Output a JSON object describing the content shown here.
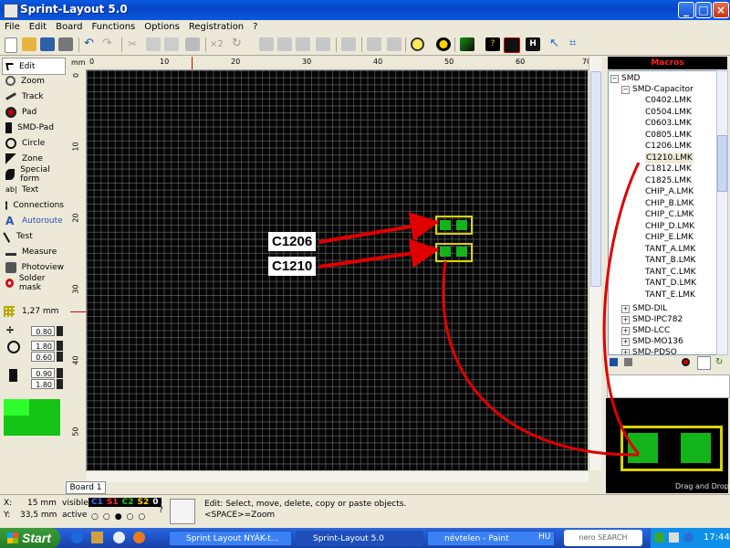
{
  "window": {
    "title": "Sprint-Layout 5.0",
    "min": "_",
    "max": "□",
    "close": "×"
  },
  "menu": [
    "File",
    "Edit",
    "Board",
    "Functions",
    "Options",
    "Registration",
    "?"
  ],
  "toolbar": {
    "x2_label": "×2"
  },
  "tools": {
    "items": [
      {
        "label": "Edit",
        "icon": "cursor-arrow-icon"
      },
      {
        "label": "Zoom",
        "icon": "magnifier-icon"
      },
      {
        "label": "Track",
        "icon": "track-pen-icon"
      },
      {
        "label": "Pad",
        "icon": "pad-icon"
      },
      {
        "label": "SMD-Pad",
        "icon": "smd-pad-icon"
      },
      {
        "label": "Circle",
        "icon": "circle-icon"
      },
      {
        "label": "Zone",
        "icon": "zone-icon"
      },
      {
        "label": "Special form",
        "icon": "special-form-icon"
      },
      {
        "label": "Text",
        "icon": "text-icon"
      },
      {
        "label": "Connections",
        "icon": "connections-icon"
      },
      {
        "label": "Autoroute",
        "icon": "autoroute-icon"
      },
      {
        "label": "Test",
        "icon": "test-icon"
      },
      {
        "label": "Measure",
        "icon": "measure-icon"
      },
      {
        "label": "Photoview",
        "icon": "photoview-icon"
      },
      {
        "label": "Solder mask",
        "icon": "solder-mask-icon"
      }
    ],
    "grid_label": "1,27 mm",
    "values": {
      "track_width": "0.80",
      "pad_outer": "1.80",
      "pad_inner": "0.60",
      "smd_w": "0.90",
      "smd_h": "1.80"
    }
  },
  "ruler": {
    "unit": "mm",
    "top": [
      "0",
      "10",
      "20",
      "30",
      "40",
      "50",
      "60",
      "70"
    ],
    "left": [
      "0",
      "10",
      "20",
      "30",
      "40",
      "50"
    ]
  },
  "callouts": {
    "a": "C1206",
    "b": "C1210"
  },
  "board_tab": "Board 1",
  "macros": {
    "title": "Macros",
    "root": "SMD",
    "group": "SMD-Capacitor",
    "files": [
      "C0402.LMK",
      "C0504.LMK",
      "C0603.LMK",
      "C0805.LMK",
      "C1206.LMK",
      "C1210.LMK",
      "C1812.LMK",
      "C1825.LMK",
      "CHIP_A.LMK",
      "CHIP_B.LMK",
      "CHIP_C.LMK",
      "CHIP_D.LMK",
      "CHIP_E.LMK",
      "TANT_A.LMK",
      "TANT_B.LMK",
      "TANT_C.LMK",
      "TANT_D.LMK",
      "TANT_E.LMK"
    ],
    "selected": "C1210.LMK",
    "other_groups": [
      "SMD-DIL",
      "SMD-IPC782",
      "SMD-LCC",
      "SMD-MO136",
      "SMD-PDSO"
    ],
    "preview_label": "Drag and Drop"
  },
  "status": {
    "x_label": "X:",
    "x_value": "15 mm",
    "y_label": "Y:",
    "y_value": "33,5 mm",
    "visible_label": "visible",
    "active_label": "active",
    "layers": [
      "C1",
      "S1",
      "C2",
      "S2",
      "0"
    ],
    "help_label": "?",
    "message_line1": "Edit: Select, move, delete, copy or paste objects.",
    "message_line2": "<SPACE>=Zoom"
  },
  "taskbar": {
    "start": "Start",
    "tasks": [
      "Sprint Layout NYÁK-t...",
      "Sprint-Layout 5.0",
      "névtelen - Paint"
    ],
    "lang": "HU",
    "nero": "nero SEARCH",
    "time": "17:44"
  },
  "colors": {
    "pad_green": "#12b41a",
    "pad_frame": "#d8d400",
    "arrow_red": "#e00000",
    "titlebar_blue": "#0a5be0"
  }
}
